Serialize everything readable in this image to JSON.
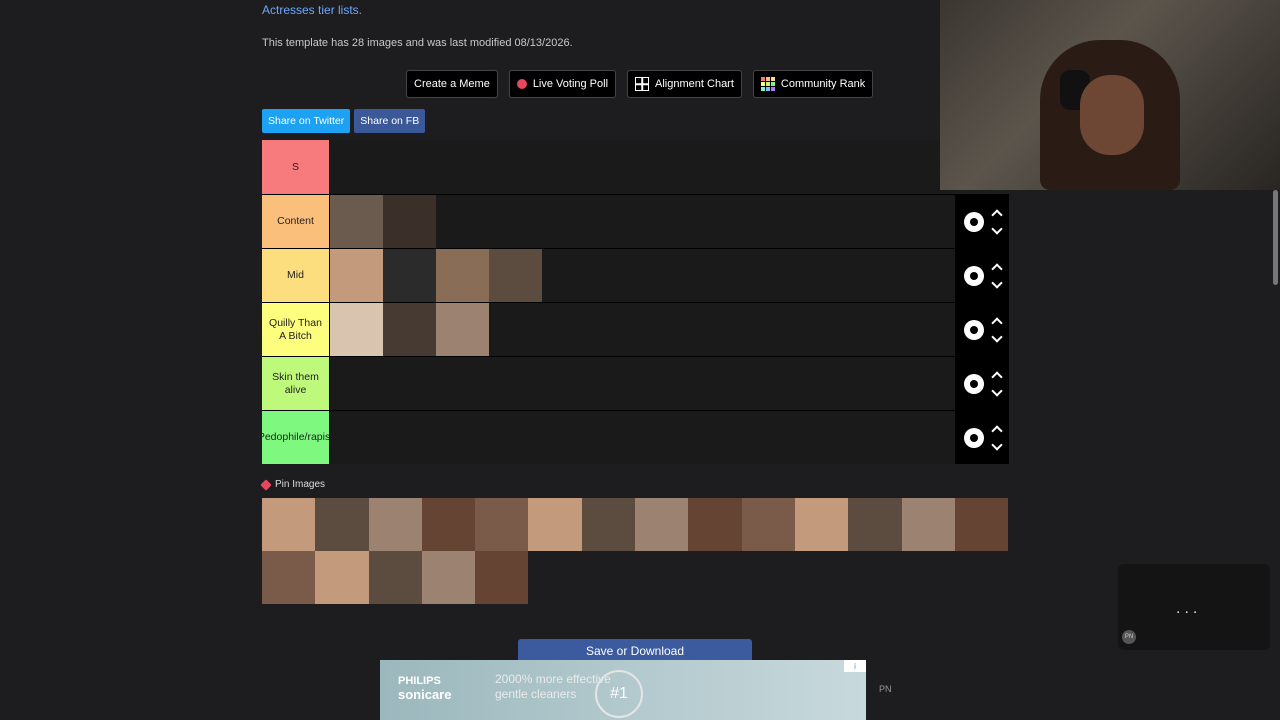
{
  "breadcrumb": "Actresses tier lists.",
  "info_text": "This template has 28 images and was last modified 08/13/2026.",
  "toolbar": [
    {
      "label": "Create a Meme",
      "icon": "none"
    },
    {
      "label": "Live Voting Poll",
      "icon": "record-dot-icon"
    },
    {
      "label": "Alignment Chart",
      "icon": "grid-icon"
    },
    {
      "label": "Community Rank",
      "icon": "rank-icon"
    }
  ],
  "share": {
    "twitter": "Share on Twitter",
    "facebook": "Share on FB"
  },
  "tiers": [
    {
      "label": "S",
      "color": "#f77a7d",
      "items": 0
    },
    {
      "label": "Content",
      "color": "#fbbf7c",
      "items": 2
    },
    {
      "label": "Mid",
      "color": "#fdde7e",
      "items": 4
    },
    {
      "label": "Quilly Than A Bitch",
      "color": "#fdfd7e",
      "items": 3
    },
    {
      "label": "Skin them alive",
      "color": "#bff97c",
      "items": 0
    },
    {
      "label": "Pedophile/rapist",
      "color": "#7ef87f",
      "items": 0
    }
  ],
  "pin_label": "Pin Images",
  "pool_count": 19,
  "save_label": "Save or Download",
  "ad": {
    "brand_top": "PHILIPS",
    "brand_bottom": "sonicare",
    "line1": "2000% more effective",
    "line2": "gentle cleaners",
    "badge": "#1",
    "choice": "i"
  },
  "pn_label": "PN",
  "panel": {
    "dots": "...",
    "badge": "PN"
  }
}
